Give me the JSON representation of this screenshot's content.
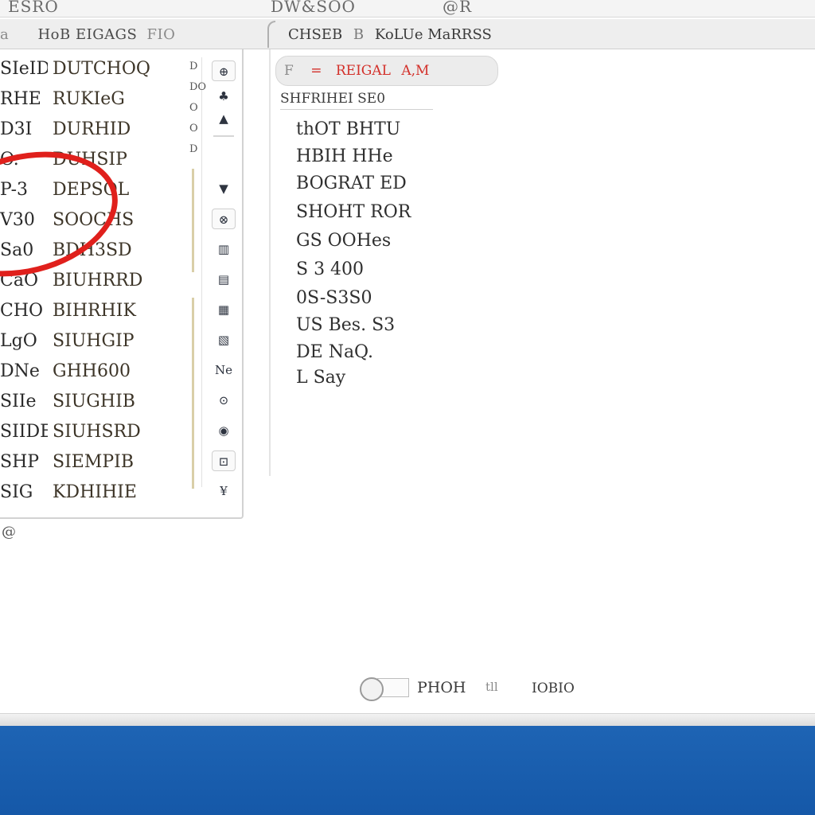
{
  "top_strip": {
    "left_text": "ESRO",
    "mid_text": "DW&SOO",
    "right_text": "@R"
  },
  "header": {
    "left_label": "a",
    "left_title": "HoB EIGAGS",
    "left_title_suffix": "FIO",
    "right_title": "CHSEB",
    "right_sep": "B",
    "right_subtitle": "KoLUe MaRRSS"
  },
  "list": {
    "rows": [
      {
        "c1": "SIeID",
        "c2": "DUTCHOQ"
      },
      {
        "c1": "RHE",
        "c2": "RUKIeG"
      },
      {
        "c1": "D3I",
        "c2": "DURHID"
      },
      {
        "c1": "O.",
        "c2": "DUHSIP"
      },
      {
        "c1": "P-3",
        "c2": "DEPSOL"
      },
      {
        "c1": "V30",
        "c2": "SOOCHS"
      },
      {
        "c1": "Sa0",
        "c2": "BDH3SD"
      },
      {
        "c1": "CaO",
        "c2": "BIUHRRD"
      },
      {
        "c1": "CHO",
        "c2": "BIHRHIK"
      },
      {
        "c1": "LgO",
        "c2": "SIUHGIP"
      },
      {
        "c1": "DNe",
        "c2": "GHH600"
      },
      {
        "c1": "SIIe",
        "c2": "SIUGHIB"
      },
      {
        "c1": "SIIDE",
        "c2": "SIUHSRD"
      },
      {
        "c1": "SHP",
        "c2": "SIEMPIB"
      },
      {
        "c1": "SIG",
        "c2": "KDHIHIE"
      }
    ],
    "track_marks": [
      "D",
      "DO",
      "O",
      "O",
      "D"
    ],
    "side_icons": [
      "⊕",
      "♣",
      "▲",
      "▼",
      "⊗",
      "▥",
      "▤",
      "▦",
      "▧",
      "Ne",
      "⊙",
      "◉",
      "⊡",
      "¥"
    ],
    "below_list_text": "@"
  },
  "detail": {
    "filter_label": "F",
    "filter_sep": "=",
    "filter_value": "REIGAL",
    "filter_suffix": "A,M",
    "section_title": "SHFRIHEI SE0",
    "rows": [
      "thOT BHTU",
      "HBIH HHe",
      "BOGRAT ED",
      "SHOHT ROR",
      "GS OOHes",
      "S 3 400",
      "0S-S3S0",
      "US Bes.   S3",
      "DE NaQ.",
      "L Say"
    ]
  },
  "footer": {
    "label": "PHOH",
    "sub_label": "tll",
    "right_label": "IOBIO"
  },
  "colors": {
    "accent_red": "#e0201c",
    "taskbar_blue": "#1e64b4"
  }
}
